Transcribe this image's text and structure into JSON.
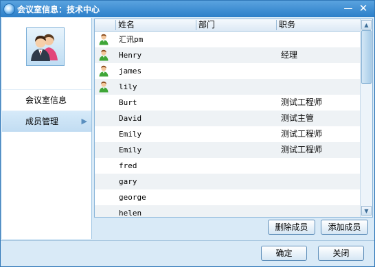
{
  "window": {
    "title": "会议室信息：技术中心"
  },
  "titlebar": {
    "minimize": "—",
    "close": "✕"
  },
  "nav": {
    "items": [
      {
        "label": "会议室信息",
        "active": false
      },
      {
        "label": "成员管理",
        "active": true,
        "arrow": "▶"
      }
    ]
  },
  "list": {
    "columns": [
      "姓名",
      "部门",
      "职务"
    ],
    "rows": [
      {
        "name": "汇讯pm",
        "dept": "",
        "title": "",
        "online": true
      },
      {
        "name": "Henry",
        "dept": "",
        "title": "经理",
        "online": true
      },
      {
        "name": "james",
        "dept": "",
        "title": "",
        "online": true
      },
      {
        "name": "lily",
        "dept": "",
        "title": "",
        "online": true
      },
      {
        "name": "Burt",
        "dept": "",
        "title": "测试工程师",
        "online": false
      },
      {
        "name": "David",
        "dept": "",
        "title": "测试主管",
        "online": false
      },
      {
        "name": "Emily",
        "dept": "",
        "title": "测试工程师",
        "online": false
      },
      {
        "name": "Emily",
        "dept": "",
        "title": "测试工程师",
        "online": false
      },
      {
        "name": "fred",
        "dept": "",
        "title": "",
        "online": false
      },
      {
        "name": "gary",
        "dept": "",
        "title": "",
        "online": false
      },
      {
        "name": "george",
        "dept": "",
        "title": "",
        "online": false
      },
      {
        "name": "helen",
        "dept": "",
        "title": "",
        "online": false
      }
    ]
  },
  "scrollbar": {
    "up": "▲",
    "down": "▼"
  },
  "buttons": {
    "remove_member": "删除成员",
    "add_member": "添加成员",
    "ok": "确定",
    "close": "关闭"
  },
  "colors": {
    "accent": "#2c7fc9",
    "panel": "#d9eaf7",
    "row_alt": "#eef2f5"
  }
}
